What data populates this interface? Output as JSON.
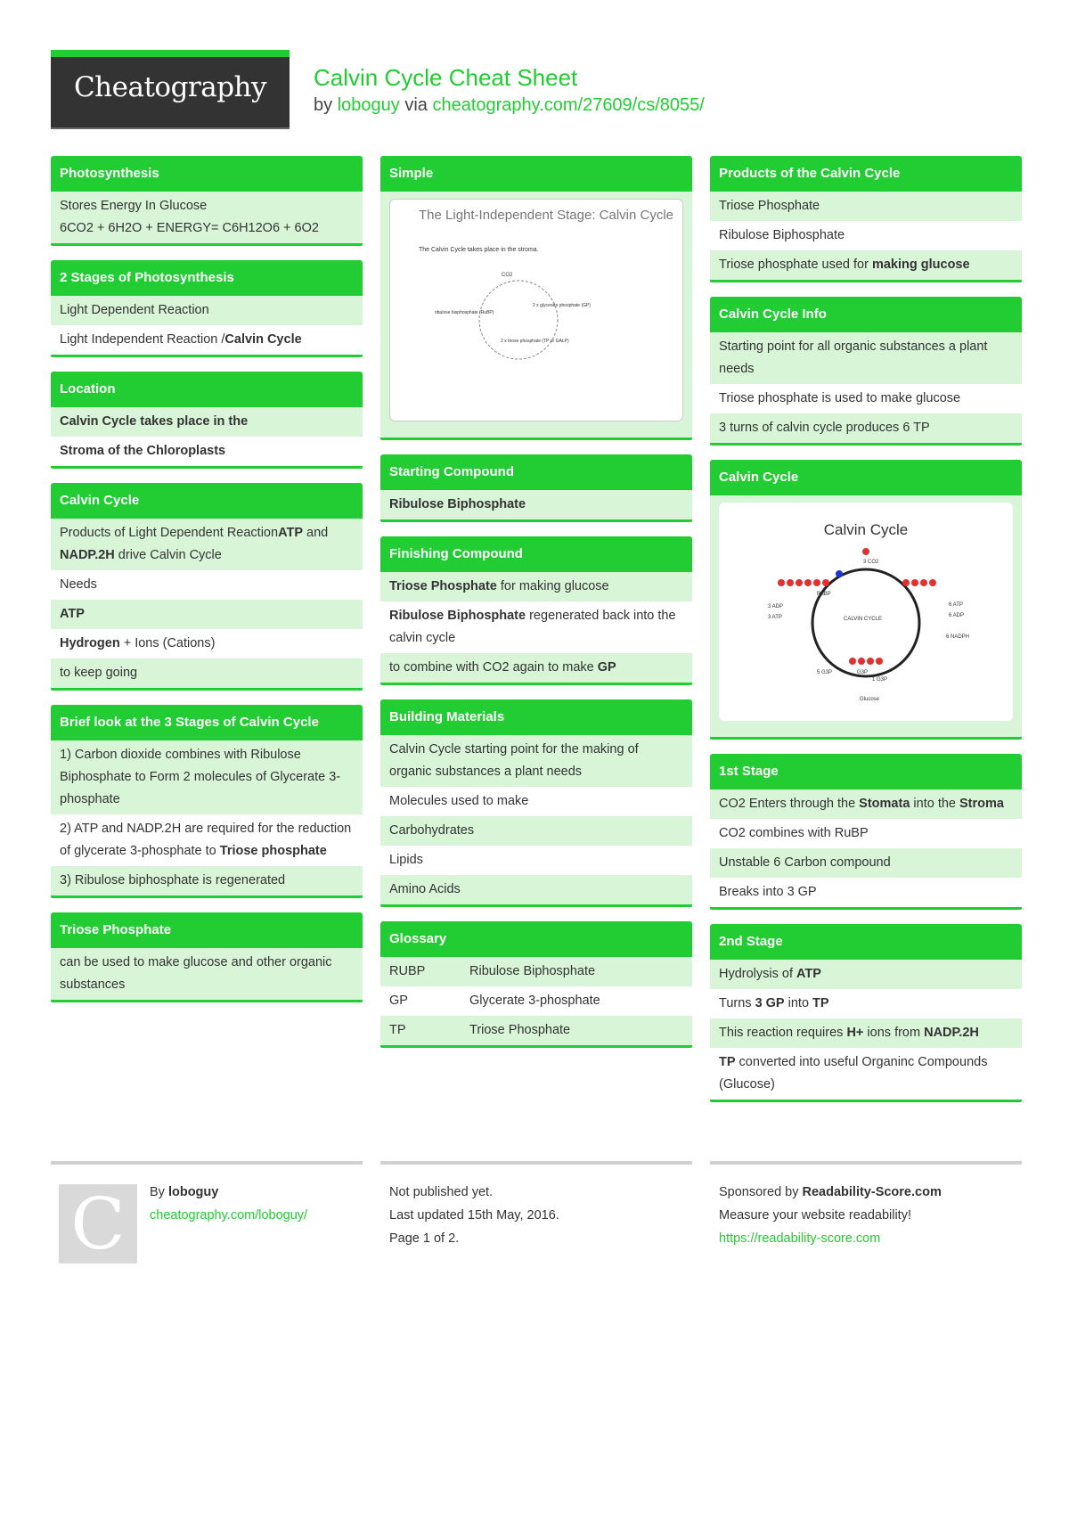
{
  "header": {
    "logo_text": "Cheatography",
    "title": "Calvin Cycle Cheat Sheet",
    "by": "by",
    "author": "loboguy",
    "via": "via",
    "url": "cheatography.com/27609/cs/8055/"
  },
  "colors": {
    "accent": "#22cc33",
    "row_alt": "#d8f5d8",
    "text": "#333333"
  },
  "columns": [
    [
      {
        "title": "Photosynthesis",
        "rows": [
          [
            [
              [
                "Stores Energy In Glucose",
                false
              ]
            ],
            [
              [
                "6CO2 + 6H2O + ENERGY= C6H12O6 + 6O2",
                false
              ]
            ]
          ]
        ],
        "merged": true
      },
      {
        "title": "2 Stages of Photosynthesis",
        "rows": [
          [
            [
              [
                "Light Dependent Reaction",
                false
              ]
            ]
          ],
          [
            [
              [
                "Light Independent Reaction /",
                false
              ],
              [
                "Calvin Cycle",
                true
              ]
            ]
          ]
        ]
      },
      {
        "title": "Location",
        "rows": [
          [
            [
              [
                "Calvin Cycle takes place in the",
                true
              ]
            ]
          ],
          [
            [
              [
                "Stroma of the Chloroplasts",
                true
              ]
            ]
          ]
        ]
      },
      {
        "title": "Calvin Cycle",
        "rows": [
          [
            [
              [
                "Products of Light Dependent Reaction",
                false
              ],
              [
                "ATP",
                true
              ],
              [
                " and ",
                false
              ],
              [
                "NADP.2H",
                true
              ],
              [
                " drive Calvin Cycle",
                false
              ]
            ]
          ],
          [
            [
              [
                "Needs",
                false
              ]
            ]
          ],
          [
            [
              [
                "ATP",
                true
              ]
            ]
          ],
          [
            [
              [
                "Hydrogen",
                true
              ],
              [
                " + Ions (Cations)",
                false
              ]
            ]
          ],
          [
            [
              [
                "to keep going",
                false
              ]
            ]
          ]
        ]
      },
      {
        "title": "Brief look at the 3 Stages of Calvin Cycle",
        "rows": [
          [
            [
              [
                "1) Carbon dioxide combines with Ribulose Biphosphate to Form 2 molecules of Glycerate 3-phosphate",
                false
              ]
            ]
          ],
          [
            [
              [
                "2) ATP and NADP.2H are required for the reduction of glycerate 3-phosphate to ",
                false
              ],
              [
                "Triose phosphate",
                true
              ]
            ]
          ],
          [
            [
              [
                "3) Ribulose biphosphate is regenerated",
                false
              ]
            ]
          ]
        ]
      },
      {
        "title": "Triose Phosphate",
        "rows": [
          [
            [
              [
                "can be used to make glucose and other organic substances",
                false
              ]
            ]
          ]
        ]
      }
    ],
    [
      {
        "title": "Simple",
        "image": "simple",
        "rows": []
      },
      {
        "title": "Starting Compound",
        "rows": [
          [
            [
              [
                "Ribulose Biphosphate",
                true
              ]
            ]
          ]
        ]
      },
      {
        "title": "Finishing Compound",
        "rows": [
          [
            [
              [
                "Triose Phosphate",
                true
              ],
              [
                " for making glucose",
                false
              ]
            ]
          ],
          [
            [
              [
                "Ribulose Biphosphate",
                true
              ],
              [
                " regenerated back into the calvin cycle",
                false
              ]
            ]
          ],
          [
            [
              [
                "to combine with CO2 again to make ",
                false
              ],
              [
                "GP",
                true
              ]
            ]
          ]
        ]
      },
      {
        "title": "Building Materials",
        "rows": [
          [
            [
              [
                "Calvin Cycle starting point for the making of organic substances a plant needs",
                false
              ]
            ]
          ],
          [
            [
              [
                "Molecules used to make",
                false
              ]
            ]
          ],
          [
            [
              [
                "Carbohydrates",
                false
              ]
            ]
          ],
          [
            [
              [
                "Lipids",
                false
              ]
            ]
          ],
          [
            [
              [
                "Amino Acids",
                false
              ]
            ]
          ]
        ]
      },
      {
        "title": "Glossary",
        "glossary": [
          [
            "RUBP",
            "Ribulose Biphosphate"
          ],
          [
            "GP",
            "Glycerate 3-phosphate"
          ],
          [
            "TP",
            "Triose Phosphate"
          ]
        ],
        "rows": []
      }
    ],
    [
      {
        "title": "Products of the Calvin Cycle",
        "rows": [
          [
            [
              [
                "Triose Phosphate",
                false
              ]
            ]
          ],
          [
            [
              [
                "Ribulose Biphosphate",
                false
              ]
            ]
          ],
          [
            [
              [
                "Triose phosphate used for ",
                false
              ],
              [
                "making glucose",
                true
              ]
            ]
          ]
        ]
      },
      {
        "title": "Calvin Cycle Info",
        "rows": [
          [
            [
              [
                "Starting point for all organic substances a plant needs",
                false
              ]
            ]
          ],
          [
            [
              [
                "Triose phosphate is used to make glucose",
                false
              ]
            ]
          ],
          [
            [
              [
                "3 turns of calvin cycle produces 6 TP",
                false
              ]
            ]
          ]
        ]
      },
      {
        "title": "Calvin Cycle",
        "image": "cycle",
        "rows": []
      },
      {
        "title": "1st Stage",
        "rows": [
          [
            [
              [
                "CO2 Enters through the ",
                false
              ],
              [
                "Stomata",
                true
              ],
              [
                " into the ",
                false
              ],
              [
                "Stroma",
                true
              ]
            ]
          ],
          [
            [
              [
                "CO2 combines with RuBP",
                false
              ]
            ]
          ],
          [
            [
              [
                "Unstable 6 Carbon compound",
                false
              ]
            ]
          ],
          [
            [
              [
                "Breaks into 3 GP",
                false
              ]
            ]
          ]
        ]
      },
      {
        "title": "2nd Stage",
        "rows": [
          [
            [
              [
                "Hydrolysis of ",
                false
              ],
              [
                "ATP",
                true
              ]
            ]
          ],
          [
            [
              [
                "Turns ",
                false
              ],
              [
                "3 GP",
                true
              ],
              [
                " into ",
                false
              ],
              [
                "TP",
                true
              ]
            ]
          ],
          [
            [
              [
                "This reaction requires ",
                false
              ],
              [
                "H+",
                true
              ],
              [
                " ions from ",
                false
              ],
              [
                "NADP.2H",
                true
              ]
            ]
          ],
          [
            [
              [
                "TP",
                true
              ],
              [
                " converted into useful Organinc Compounds (Glucose)",
                false
              ]
            ]
          ]
        ]
      }
    ]
  ],
  "images": {
    "simple": {
      "title": "The Light-Independent Stage: Calvin Cycle",
      "caption": "The Calvin Cycle takes place in the stroma.",
      "labels": [
        "CO2",
        "2 x glycerate phosphate (GP)",
        "2 x triose phosphate (TP or GALP)",
        "ribulose bisphosphate (RuBP)"
      ]
    },
    "cycle": {
      "title": "Calvin Cycle",
      "labels": [
        "3 CO2",
        "RuBP",
        "CALVIN CYCLE",
        "6 ATP",
        "6 ADP",
        "6 NADPH",
        "3 ADP",
        "3 ATP",
        "G3P",
        "5 G3P",
        "1 G3P",
        "Glucose"
      ]
    }
  },
  "footer": {
    "logo_letter": "C",
    "by": "By",
    "author": "loboguy",
    "author_url": "cheatography.com/loboguy/",
    "published": "Not published yet.",
    "updated": "Last updated 15th May, 2016.",
    "page": "Page 1 of 2.",
    "sponsored": "Sponsored by",
    "sponsor": "Readability-Score.com",
    "sponsor_tag": "Measure your website readability!",
    "sponsor_url": "https://readability-score.com"
  }
}
